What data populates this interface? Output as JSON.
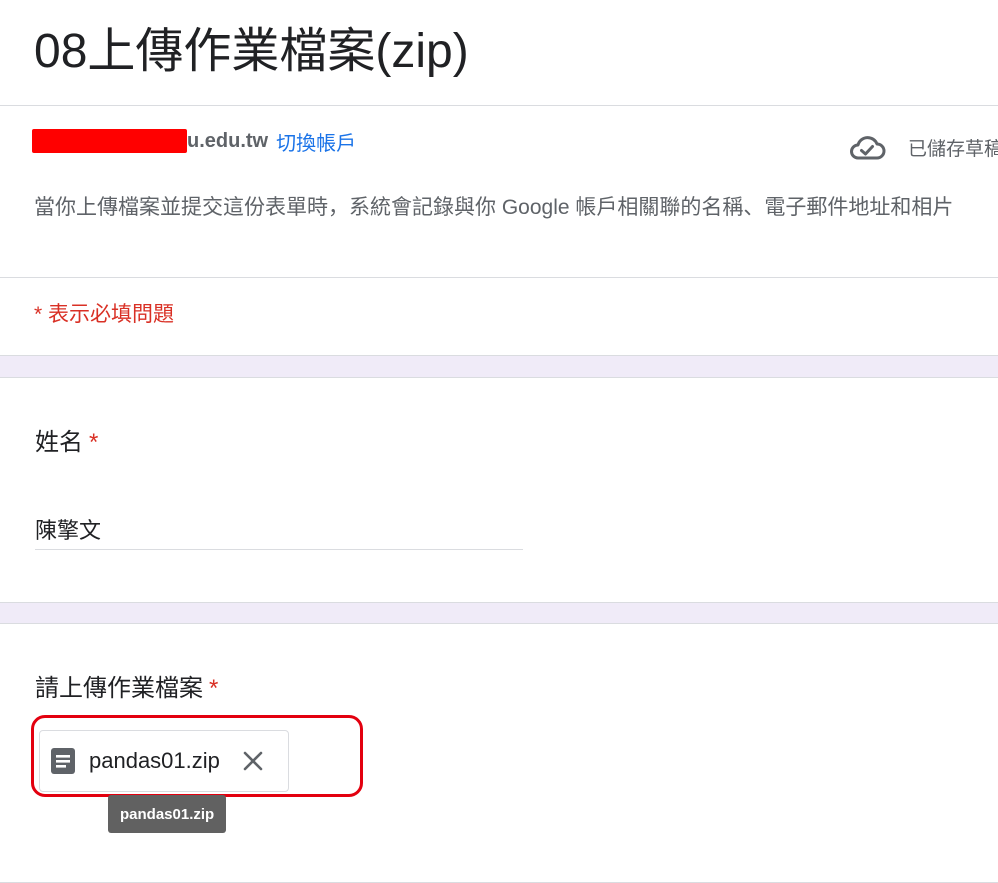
{
  "form": {
    "title": "08上傳作業檔案(zip)",
    "account": {
      "email_visible_suffix": "u.edu.tw",
      "switch_label": "切換帳戶"
    },
    "saved_status": "已儲存草稿",
    "notice": "當你上傳檔案並提交這份表單時，系統會記錄與你 Google 帳戶相關聯的名稱、電子郵件地址和相片",
    "required_note": "* 表示必填問題"
  },
  "questions": [
    {
      "title": "姓名",
      "required_mark": "*",
      "answer": "陳擎文"
    },
    {
      "title": "請上傳作業檔案",
      "required_mark": "*",
      "file": {
        "name": "pandas01.zip",
        "tooltip": "pandas01.zip"
      }
    }
  ],
  "colors": {
    "background": "#f0ebf8",
    "required": "#d93025",
    "link": "#1a73e8",
    "annotation_box": "#e3000f",
    "redaction": "#ff0000"
  },
  "icons": {
    "saved": "cloud-check-icon",
    "file": "document-icon",
    "remove": "close-icon"
  }
}
